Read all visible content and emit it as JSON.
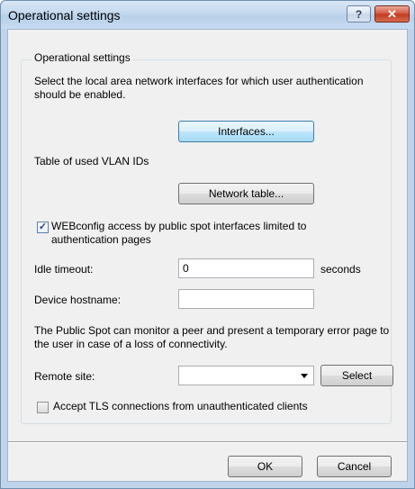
{
  "window": {
    "title": "Operational settings",
    "help_label": "?",
    "close_label": "✕"
  },
  "group": {
    "title": "Operational settings",
    "interfaces_desc": "Select the local area network interfaces for which user authentication should be enabled.",
    "interfaces_button": "Interfaces...",
    "vlan_label": "Table of used VLAN IDs",
    "network_table_button": "Network table...",
    "webconfig_checkbox": {
      "checked": true,
      "label": "WEBconfig access by public spot interfaces limited to authentication pages"
    },
    "idle_timeout": {
      "label": "Idle timeout:",
      "value": "0",
      "unit": "seconds"
    },
    "device_hostname": {
      "label": "Device hostname:",
      "value": ""
    },
    "monitor_desc": "The Public Spot can monitor a peer and present a temporary error page to the user in case of a loss of connectivity.",
    "remote_site": {
      "label": "Remote site:",
      "value": "",
      "select_button": "Select"
    },
    "tls_checkbox": {
      "checked": false,
      "label": "Accept TLS connections from unauthenticated clients"
    }
  },
  "footer": {
    "ok_button": "OK",
    "cancel_button": "Cancel"
  }
}
